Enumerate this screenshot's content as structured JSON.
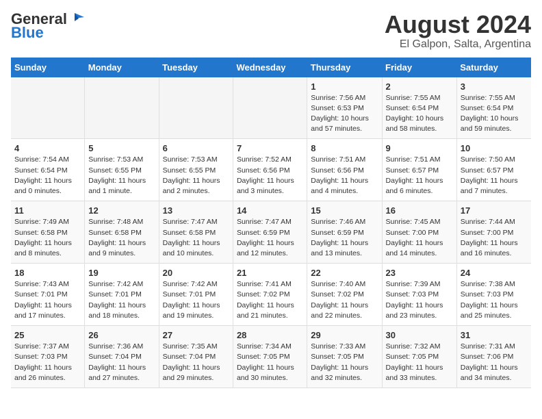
{
  "header": {
    "logo_general": "General",
    "logo_blue": "Blue",
    "title": "August 2024",
    "subtitle": "El Galpon, Salta, Argentina"
  },
  "columns": [
    "Sunday",
    "Monday",
    "Tuesday",
    "Wednesday",
    "Thursday",
    "Friday",
    "Saturday"
  ],
  "weeks": [
    {
      "days": [
        {
          "date": "",
          "info": ""
        },
        {
          "date": "",
          "info": ""
        },
        {
          "date": "",
          "info": ""
        },
        {
          "date": "",
          "info": ""
        },
        {
          "date": "1",
          "info": "Sunrise: 7:56 AM\nSunset: 6:53 PM\nDaylight: 10 hours\nand 57 minutes."
        },
        {
          "date": "2",
          "info": "Sunrise: 7:55 AM\nSunset: 6:54 PM\nDaylight: 10 hours\nand 58 minutes."
        },
        {
          "date": "3",
          "info": "Sunrise: 7:55 AM\nSunset: 6:54 PM\nDaylight: 10 hours\nand 59 minutes."
        }
      ]
    },
    {
      "days": [
        {
          "date": "4",
          "info": "Sunrise: 7:54 AM\nSunset: 6:54 PM\nDaylight: 11 hours\nand 0 minutes."
        },
        {
          "date": "5",
          "info": "Sunrise: 7:53 AM\nSunset: 6:55 PM\nDaylight: 11 hours\nand 1 minute."
        },
        {
          "date": "6",
          "info": "Sunrise: 7:53 AM\nSunset: 6:55 PM\nDaylight: 11 hours\nand 2 minutes."
        },
        {
          "date": "7",
          "info": "Sunrise: 7:52 AM\nSunset: 6:56 PM\nDaylight: 11 hours\nand 3 minutes."
        },
        {
          "date": "8",
          "info": "Sunrise: 7:51 AM\nSunset: 6:56 PM\nDaylight: 11 hours\nand 4 minutes."
        },
        {
          "date": "9",
          "info": "Sunrise: 7:51 AM\nSunset: 6:57 PM\nDaylight: 11 hours\nand 6 minutes."
        },
        {
          "date": "10",
          "info": "Sunrise: 7:50 AM\nSunset: 6:57 PM\nDaylight: 11 hours\nand 7 minutes."
        }
      ]
    },
    {
      "days": [
        {
          "date": "11",
          "info": "Sunrise: 7:49 AM\nSunset: 6:58 PM\nDaylight: 11 hours\nand 8 minutes."
        },
        {
          "date": "12",
          "info": "Sunrise: 7:48 AM\nSunset: 6:58 PM\nDaylight: 11 hours\nand 9 minutes."
        },
        {
          "date": "13",
          "info": "Sunrise: 7:47 AM\nSunset: 6:58 PM\nDaylight: 11 hours\nand 10 minutes."
        },
        {
          "date": "14",
          "info": "Sunrise: 7:47 AM\nSunset: 6:59 PM\nDaylight: 11 hours\nand 12 minutes."
        },
        {
          "date": "15",
          "info": "Sunrise: 7:46 AM\nSunset: 6:59 PM\nDaylight: 11 hours\nand 13 minutes."
        },
        {
          "date": "16",
          "info": "Sunrise: 7:45 AM\nSunset: 7:00 PM\nDaylight: 11 hours\nand 14 minutes."
        },
        {
          "date": "17",
          "info": "Sunrise: 7:44 AM\nSunset: 7:00 PM\nDaylight: 11 hours\nand 16 minutes."
        }
      ]
    },
    {
      "days": [
        {
          "date": "18",
          "info": "Sunrise: 7:43 AM\nSunset: 7:01 PM\nDaylight: 11 hours\nand 17 minutes."
        },
        {
          "date": "19",
          "info": "Sunrise: 7:42 AM\nSunset: 7:01 PM\nDaylight: 11 hours\nand 18 minutes."
        },
        {
          "date": "20",
          "info": "Sunrise: 7:42 AM\nSunset: 7:01 PM\nDaylight: 11 hours\nand 19 minutes."
        },
        {
          "date": "21",
          "info": "Sunrise: 7:41 AM\nSunset: 7:02 PM\nDaylight: 11 hours\nand 21 minutes."
        },
        {
          "date": "22",
          "info": "Sunrise: 7:40 AM\nSunset: 7:02 PM\nDaylight: 11 hours\nand 22 minutes."
        },
        {
          "date": "23",
          "info": "Sunrise: 7:39 AM\nSunset: 7:03 PM\nDaylight: 11 hours\nand 23 minutes."
        },
        {
          "date": "24",
          "info": "Sunrise: 7:38 AM\nSunset: 7:03 PM\nDaylight: 11 hours\nand 25 minutes."
        }
      ]
    },
    {
      "days": [
        {
          "date": "25",
          "info": "Sunrise: 7:37 AM\nSunset: 7:03 PM\nDaylight: 11 hours\nand 26 minutes."
        },
        {
          "date": "26",
          "info": "Sunrise: 7:36 AM\nSunset: 7:04 PM\nDaylight: 11 hours\nand 27 minutes."
        },
        {
          "date": "27",
          "info": "Sunrise: 7:35 AM\nSunset: 7:04 PM\nDaylight: 11 hours\nand 29 minutes."
        },
        {
          "date": "28",
          "info": "Sunrise: 7:34 AM\nSunset: 7:05 PM\nDaylight: 11 hours\nand 30 minutes."
        },
        {
          "date": "29",
          "info": "Sunrise: 7:33 AM\nSunset: 7:05 PM\nDaylight: 11 hours\nand 32 minutes."
        },
        {
          "date": "30",
          "info": "Sunrise: 7:32 AM\nSunset: 7:05 PM\nDaylight: 11 hours\nand 33 minutes."
        },
        {
          "date": "31",
          "info": "Sunrise: 7:31 AM\nSunset: 7:06 PM\nDaylight: 11 hours\nand 34 minutes."
        }
      ]
    }
  ]
}
